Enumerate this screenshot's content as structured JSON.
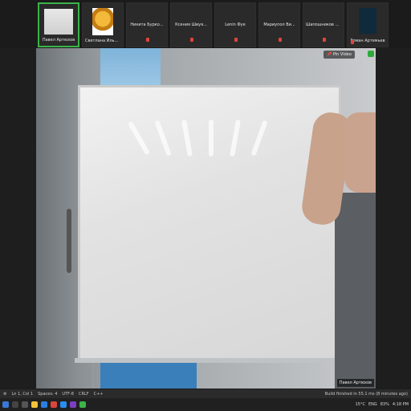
{
  "participants": [
    {
      "name": "Павел Артюхов",
      "style": "active",
      "thumb": "board"
    },
    {
      "name": "Светлана Ильичева",
      "style": "normal",
      "thumb": "photo"
    },
    {
      "name": "Никита Бурко...",
      "style": "normal",
      "thumb": "none"
    },
    {
      "name": "Ксения Шиуя...",
      "style": "normal",
      "thumb": "none"
    },
    {
      "name": "Lenin Фуе",
      "style": "normal",
      "thumb": "none"
    },
    {
      "name": "Мариупол Ви...",
      "style": "normal",
      "thumb": "none"
    },
    {
      "name": "Шапошников А...",
      "style": "normal",
      "thumb": "none"
    },
    {
      "name": "Роман Артемьев",
      "style": "normal",
      "thumb": "avatar"
    }
  ],
  "video": {
    "pin_label": "Pin Video",
    "speaker_name": "Павел Артюхов"
  },
  "statusbar": {
    "left": "Ln 1, Col 1",
    "mid1": "Spaces: 4",
    "mid2": "UTF-8",
    "mid3": "CRLF",
    "mid4": "C++",
    "right": "Build finished in 55.1 ms (8 minutes ago)"
  },
  "taskbar": {
    "weather": "15°C",
    "lang": "ENG",
    "battery": "83%",
    "time": "4:18 PM"
  },
  "colors": {
    "accent_active": "#3bb34a",
    "mic_muted": "#e0453a"
  }
}
